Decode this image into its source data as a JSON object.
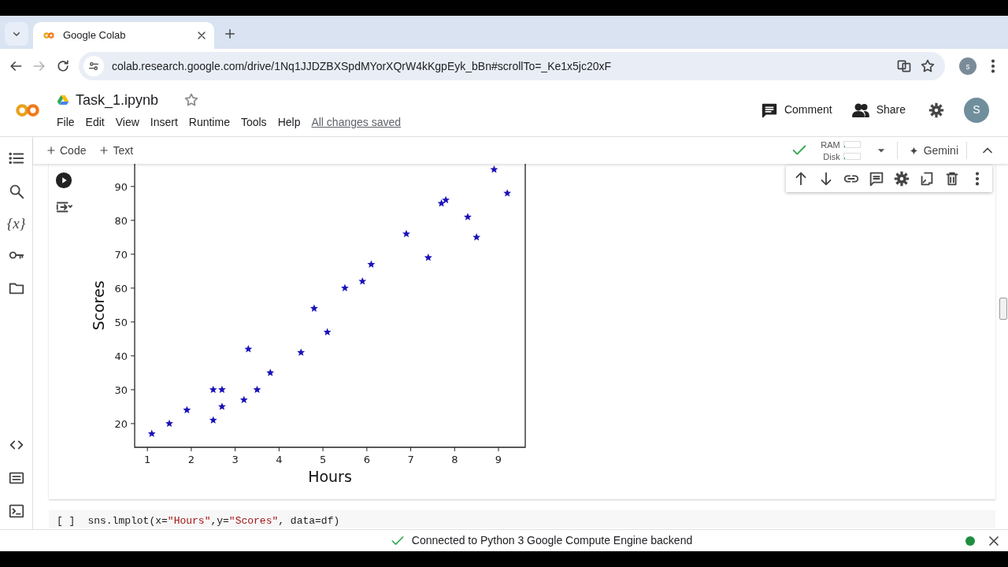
{
  "browser": {
    "tab_title": "Google Colab",
    "url": "colab.research.google.com/drive/1Nq1JJDZBXSpdMYorXQrW4kKgpEyk_bBn#scrollTo=_Ke1x5jc20xF",
    "profile_initial": "s"
  },
  "notebook": {
    "title": "Task_1.ipynb",
    "starred": false,
    "menu": [
      "File",
      "Edit",
      "View",
      "Insert",
      "Runtime",
      "Tools",
      "Help"
    ],
    "save_status": "All changes saved"
  },
  "header_actions": {
    "comment": "Comment",
    "share": "Share",
    "avatar_initial": "S"
  },
  "toolbar": {
    "add_buttons": [
      "Code",
      "Text"
    ],
    "runtime_connected": true,
    "meters": [
      {
        "label": "RAM",
        "level": 0.05
      },
      {
        "label": "Disk",
        "level": 0.05
      }
    ],
    "gemini": "Gemini"
  },
  "sidebar": {
    "variables_label": "{x}"
  },
  "cell_output": {
    "chart_data": {
      "type": "scatter",
      "xlabel": "Hours",
      "ylabel": "Scores",
      "x": [
        1.1,
        1.5,
        1.9,
        2.5,
        2.5,
        2.7,
        2.7,
        3.2,
        3.3,
        3.5,
        3.8,
        4.5,
        4.8,
        5.1,
        5.5,
        5.9,
        6.1,
        6.9,
        7.4,
        7.7,
        7.8,
        8.3,
        8.5,
        8.9,
        9.2
      ],
      "series": [
        {
          "color": "#1a12b8",
          "values": [
            17,
            20,
            24,
            21,
            30,
            30,
            25,
            27,
            42,
            30,
            35,
            41,
            54,
            47,
            60,
            62,
            67,
            76,
            69,
            85,
            86,
            81,
            75,
            95,
            88
          ]
        }
      ],
      "xlim": [
        0.71,
        9.61
      ],
      "ylim": [
        13,
        96.7
      ],
      "xticks": [
        1,
        2,
        3,
        4,
        5,
        6,
        7,
        8,
        9
      ],
      "yticks": [
        20,
        30,
        40,
        50,
        60,
        70,
        80,
        90
      ]
    }
  },
  "next_cell": {
    "run_label": "[ ]",
    "code": [
      {
        "kind": "plain",
        "text": "sns.lmplot(x="
      },
      {
        "kind": "string",
        "text": "\"Hours\""
      },
      {
        "kind": "plain",
        "text": ",y="
      },
      {
        "kind": "string",
        "text": "\"Scores\""
      },
      {
        "kind": "plain",
        "text": ", data=df)"
      }
    ]
  },
  "status_bar": {
    "message": "Connected to Python 3 Google Compute Engine backend",
    "connected": true
  }
}
